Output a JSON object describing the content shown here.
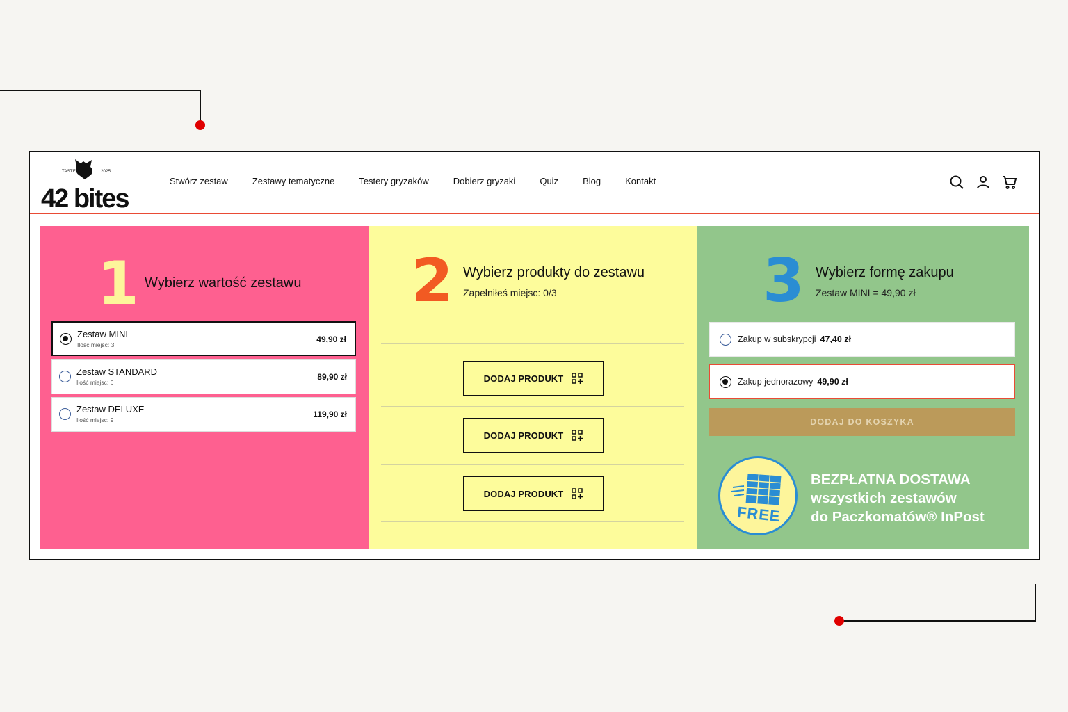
{
  "brand": {
    "logo_text": "42 bites",
    "logo_small_left": "TASTE",
    "logo_small_right": "2025"
  },
  "nav": {
    "items": [
      {
        "label": "Stwórz zestaw"
      },
      {
        "label": "Zestawy tematyczne"
      },
      {
        "label": "Testery gryzaków"
      },
      {
        "label": "Dobierz gryzaki"
      },
      {
        "label": "Quiz"
      },
      {
        "label": "Blog"
      },
      {
        "label": "Kontakt"
      }
    ]
  },
  "header_icons": [
    "search-icon",
    "user-icon",
    "cart-icon"
  ],
  "step1": {
    "number": "1",
    "title": "Wybierz wartość zestawu",
    "options": [
      {
        "name": "Zestaw MINI",
        "seats": "Ilość miejsc: 3",
        "price": "49,90 zł",
        "selected": true
      },
      {
        "name": "Zestaw STANDARD",
        "seats": "Ilość miejsc: 6",
        "price": "89,90 zł",
        "selected": false
      },
      {
        "name": "Zestaw DELUXE",
        "seats": "Ilość miejsc: 9",
        "price": "119,90 zł",
        "selected": false
      }
    ]
  },
  "step2": {
    "number": "2",
    "title": "Wybierz produkty do zestawu",
    "subtitle": "Zapełniłeś miejsc: 0/3",
    "add_buttons": [
      {
        "label": "DODAJ PRODUKT"
      },
      {
        "label": "DODAJ PRODUKT"
      },
      {
        "label": "DODAJ PRODUKT"
      }
    ]
  },
  "step3": {
    "number": "3",
    "title": "Wybierz formę zakupu",
    "subtitle": "Zestaw MINI = 49,90 zł",
    "payment_options": [
      {
        "label": "Zakup w subskrypcji",
        "price": "47,40 zł",
        "selected": false
      },
      {
        "label": "Zakup jednorazowy",
        "price": "49,90 zł",
        "selected": true
      }
    ],
    "cart_button": "DODAJ DO KOSZYKA",
    "free_badge": "FREE",
    "delivery": {
      "line1": "BEZPŁATNA DOSTAWA",
      "line2": "wszystkich zestawów",
      "line3": "do Paczkomatów® InPost"
    }
  },
  "colors": {
    "pink": "#fe6090",
    "yellow": "#fdfc9b",
    "green": "#92c68b",
    "num1": "#fdf59b",
    "num2": "#f25a22",
    "num3": "#2a8dd3",
    "accent_red": "#e94b35",
    "cart_button": "#bb9a5a"
  }
}
